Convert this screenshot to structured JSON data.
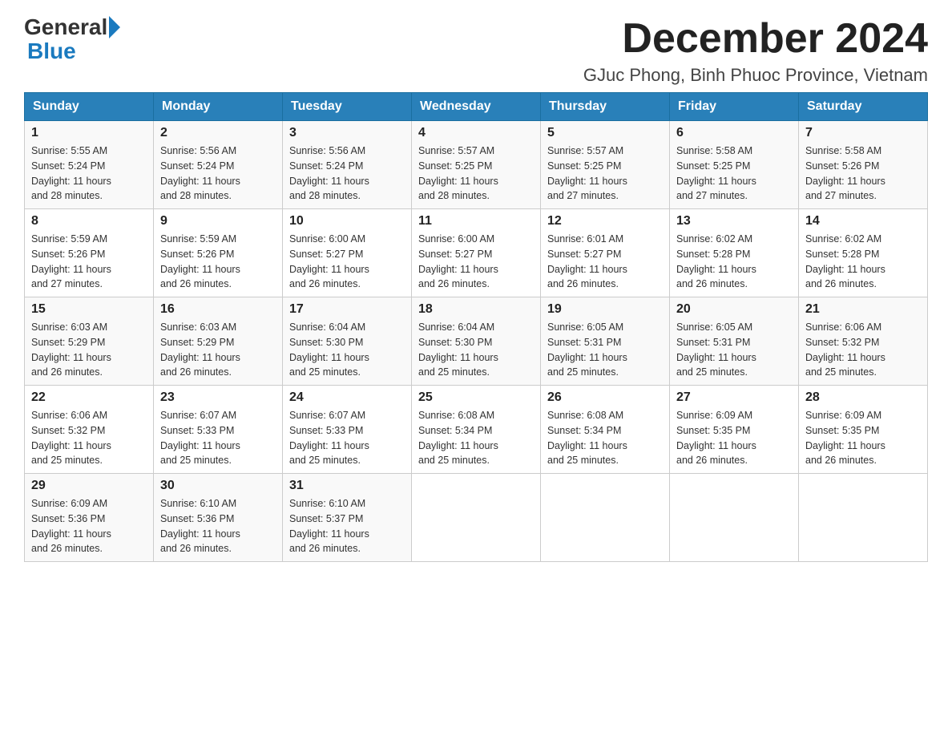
{
  "logo": {
    "general": "General",
    "blue": "Blue"
  },
  "title": {
    "month": "December 2024",
    "location": "GJuc Phong, Binh Phuoc Province, Vietnam"
  },
  "headers": [
    "Sunday",
    "Monday",
    "Tuesday",
    "Wednesday",
    "Thursday",
    "Friday",
    "Saturday"
  ],
  "weeks": [
    [
      {
        "day": "1",
        "sunrise": "5:55 AM",
        "sunset": "5:24 PM",
        "daylight": "11 hours and 28 minutes."
      },
      {
        "day": "2",
        "sunrise": "5:56 AM",
        "sunset": "5:24 PM",
        "daylight": "11 hours and 28 minutes."
      },
      {
        "day": "3",
        "sunrise": "5:56 AM",
        "sunset": "5:24 PM",
        "daylight": "11 hours and 28 minutes."
      },
      {
        "day": "4",
        "sunrise": "5:57 AM",
        "sunset": "5:25 PM",
        "daylight": "11 hours and 28 minutes."
      },
      {
        "day": "5",
        "sunrise": "5:57 AM",
        "sunset": "5:25 PM",
        "daylight": "11 hours and 27 minutes."
      },
      {
        "day": "6",
        "sunrise": "5:58 AM",
        "sunset": "5:25 PM",
        "daylight": "11 hours and 27 minutes."
      },
      {
        "day": "7",
        "sunrise": "5:58 AM",
        "sunset": "5:26 PM",
        "daylight": "11 hours and 27 minutes."
      }
    ],
    [
      {
        "day": "8",
        "sunrise": "5:59 AM",
        "sunset": "5:26 PM",
        "daylight": "11 hours and 27 minutes."
      },
      {
        "day": "9",
        "sunrise": "5:59 AM",
        "sunset": "5:26 PM",
        "daylight": "11 hours and 26 minutes."
      },
      {
        "day": "10",
        "sunrise": "6:00 AM",
        "sunset": "5:27 PM",
        "daylight": "11 hours and 26 minutes."
      },
      {
        "day": "11",
        "sunrise": "6:00 AM",
        "sunset": "5:27 PM",
        "daylight": "11 hours and 26 minutes."
      },
      {
        "day": "12",
        "sunrise": "6:01 AM",
        "sunset": "5:27 PM",
        "daylight": "11 hours and 26 minutes."
      },
      {
        "day": "13",
        "sunrise": "6:02 AM",
        "sunset": "5:28 PM",
        "daylight": "11 hours and 26 minutes."
      },
      {
        "day": "14",
        "sunrise": "6:02 AM",
        "sunset": "5:28 PM",
        "daylight": "11 hours and 26 minutes."
      }
    ],
    [
      {
        "day": "15",
        "sunrise": "6:03 AM",
        "sunset": "5:29 PM",
        "daylight": "11 hours and 26 minutes."
      },
      {
        "day": "16",
        "sunrise": "6:03 AM",
        "sunset": "5:29 PM",
        "daylight": "11 hours and 26 minutes."
      },
      {
        "day": "17",
        "sunrise": "6:04 AM",
        "sunset": "5:30 PM",
        "daylight": "11 hours and 25 minutes."
      },
      {
        "day": "18",
        "sunrise": "6:04 AM",
        "sunset": "5:30 PM",
        "daylight": "11 hours and 25 minutes."
      },
      {
        "day": "19",
        "sunrise": "6:05 AM",
        "sunset": "5:31 PM",
        "daylight": "11 hours and 25 minutes."
      },
      {
        "day": "20",
        "sunrise": "6:05 AM",
        "sunset": "5:31 PM",
        "daylight": "11 hours and 25 minutes."
      },
      {
        "day": "21",
        "sunrise": "6:06 AM",
        "sunset": "5:32 PM",
        "daylight": "11 hours and 25 minutes."
      }
    ],
    [
      {
        "day": "22",
        "sunrise": "6:06 AM",
        "sunset": "5:32 PM",
        "daylight": "11 hours and 25 minutes."
      },
      {
        "day": "23",
        "sunrise": "6:07 AM",
        "sunset": "5:33 PM",
        "daylight": "11 hours and 25 minutes."
      },
      {
        "day": "24",
        "sunrise": "6:07 AM",
        "sunset": "5:33 PM",
        "daylight": "11 hours and 25 minutes."
      },
      {
        "day": "25",
        "sunrise": "6:08 AM",
        "sunset": "5:34 PM",
        "daylight": "11 hours and 25 minutes."
      },
      {
        "day": "26",
        "sunrise": "6:08 AM",
        "sunset": "5:34 PM",
        "daylight": "11 hours and 25 minutes."
      },
      {
        "day": "27",
        "sunrise": "6:09 AM",
        "sunset": "5:35 PM",
        "daylight": "11 hours and 26 minutes."
      },
      {
        "day": "28",
        "sunrise": "6:09 AM",
        "sunset": "5:35 PM",
        "daylight": "11 hours and 26 minutes."
      }
    ],
    [
      {
        "day": "29",
        "sunrise": "6:09 AM",
        "sunset": "5:36 PM",
        "daylight": "11 hours and 26 minutes."
      },
      {
        "day": "30",
        "sunrise": "6:10 AM",
        "sunset": "5:36 PM",
        "daylight": "11 hours and 26 minutes."
      },
      {
        "day": "31",
        "sunrise": "6:10 AM",
        "sunset": "5:37 PM",
        "daylight": "11 hours and 26 minutes."
      },
      null,
      null,
      null,
      null
    ]
  ],
  "labels": {
    "sunrise": "Sunrise:",
    "sunset": "Sunset:",
    "daylight": "Daylight:"
  }
}
